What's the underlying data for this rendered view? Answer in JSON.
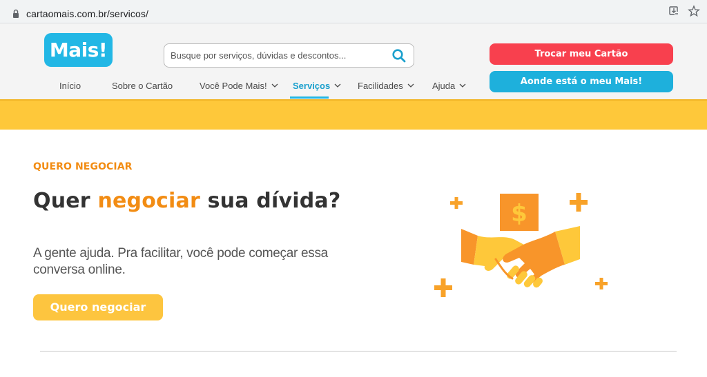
{
  "browser": {
    "url": "cartaomais.com.br/servicos/"
  },
  "header": {
    "logo_text": "Mais!",
    "search": {
      "placeholder": "Busque por serviços, dúvidas e descontos..."
    },
    "nav": [
      {
        "label": "Início",
        "has_chevron": false
      },
      {
        "label": "Sobre o Cartão",
        "has_chevron": false
      },
      {
        "label": "Você Pode Mais!",
        "has_chevron": true
      },
      {
        "label": "Serviços",
        "has_chevron": true,
        "active": true
      },
      {
        "label": "Facilidades",
        "has_chevron": true
      },
      {
        "label": "Ajuda",
        "has_chevron": true
      }
    ],
    "buttons": {
      "trocar": "Trocar meu Cartão",
      "aonde": "Aonde está o meu Mais!"
    }
  },
  "hero": {
    "eyebrow": "QUERO NEGOCIAR",
    "headline": {
      "before": "Quer ",
      "highlight": "negociar",
      "after": " sua dívida?"
    },
    "subtext": "A gente ajuda. Pra facilitar, você pode começar essa conversa online.",
    "cta": "Quero negociar"
  },
  "colors": {
    "brand_blue": "#22b7e5",
    "accent_orange": "#f28c13",
    "red_button": "#f8404e",
    "yellow_band": "#fec83a",
    "cta_yellow": "#fdc53f"
  },
  "icons": [
    "lock-icon",
    "install-icon",
    "star-icon",
    "search-icon",
    "chevron-down-icon",
    "handshake-illustration",
    "plus-icon",
    "dollar-icon"
  ]
}
